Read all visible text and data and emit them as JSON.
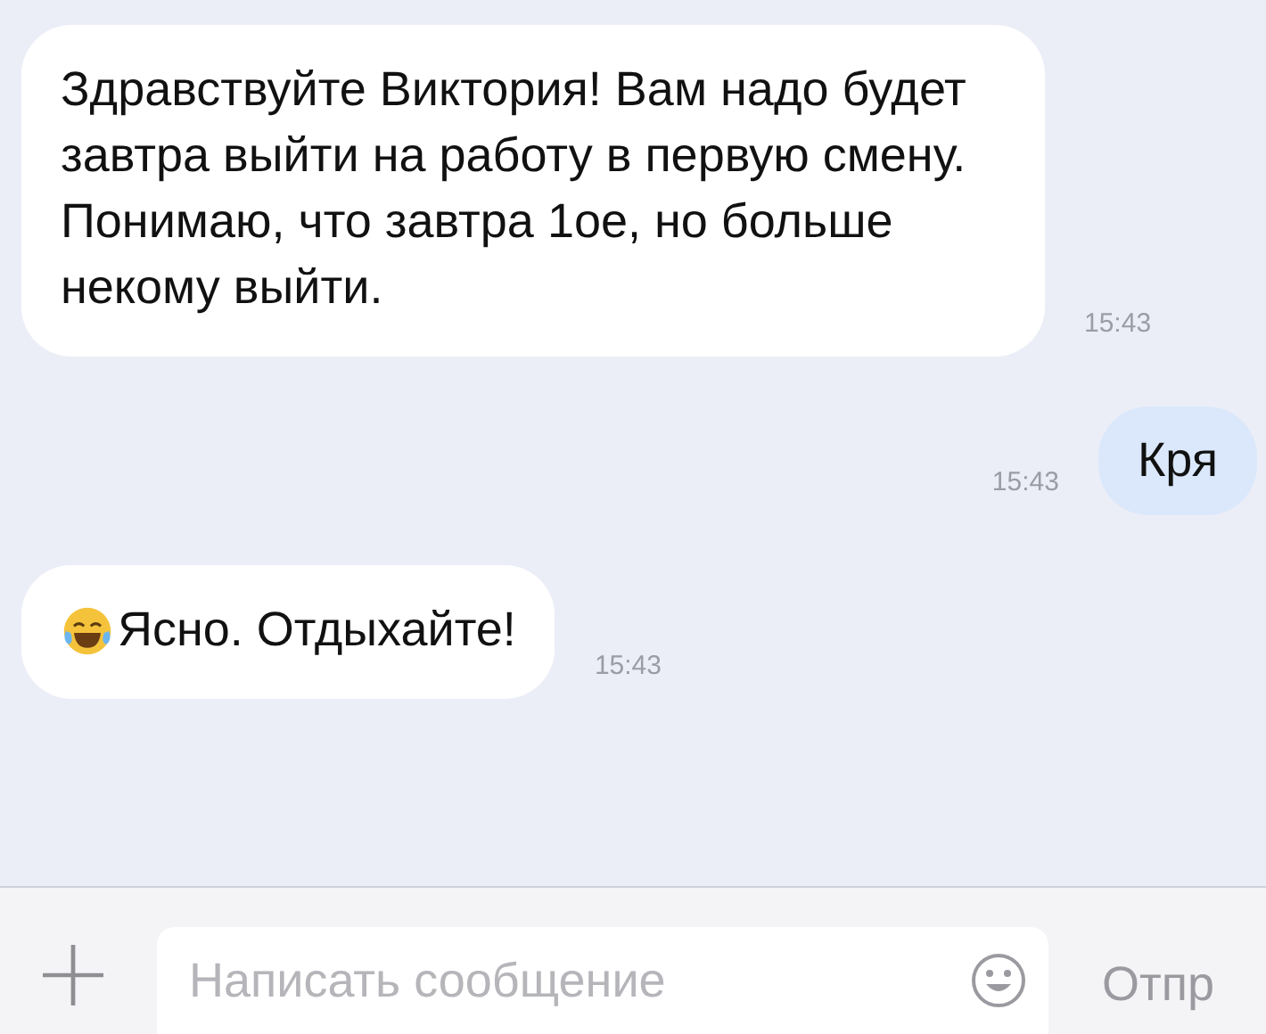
{
  "messages": [
    {
      "kind": "incoming",
      "text": "Здравствуйте Виктория! Вам надо будет завтра выйти на работу в первую смену. Понимаю, что завтра 1ое, но больше некому выйти.",
      "time": "15:43",
      "emoji": false
    },
    {
      "kind": "outgoing",
      "text": "Кря",
      "time": "15:43",
      "emoji": false
    },
    {
      "kind": "incoming",
      "text": "Ясно. Отдыхайте!",
      "time": "15:43",
      "emoji": true
    }
  ],
  "composer": {
    "placeholder": "Написать сообщение",
    "send": "Отпр"
  }
}
